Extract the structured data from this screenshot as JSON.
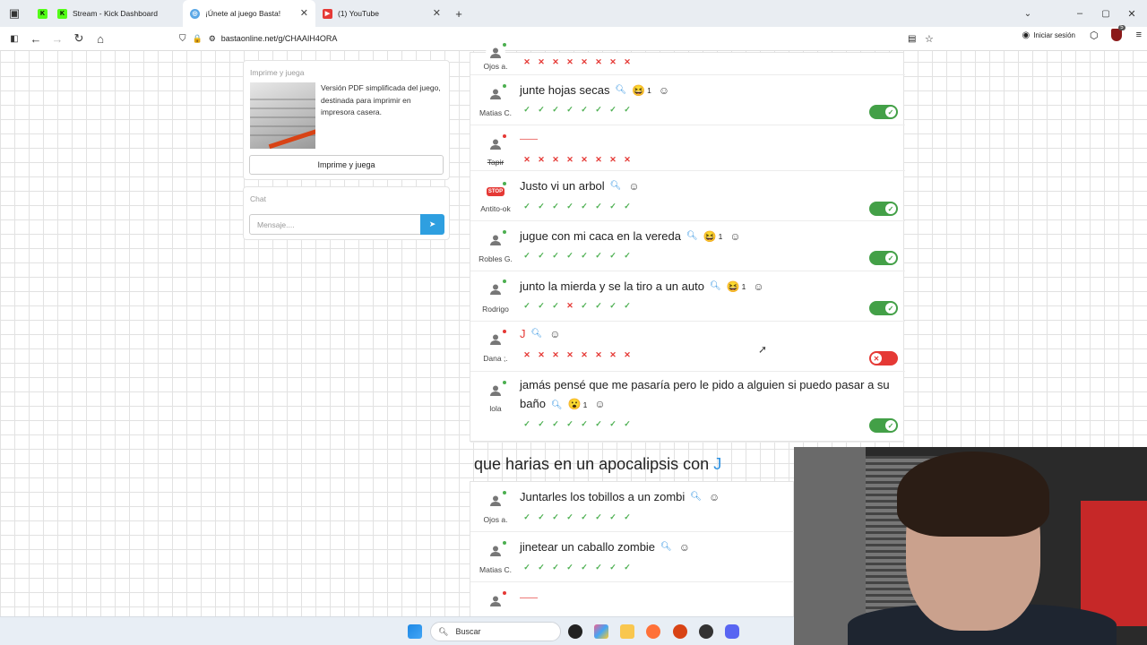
{
  "tabs": [
    {
      "label": "Stream - Kick Dashboard",
      "icon": "kick-icon",
      "active": false
    },
    {
      "label": "¡Únete al juego Basta!",
      "icon": "basta-icon",
      "active": true
    },
    {
      "label": "(1) YouTube",
      "icon": "youtube-icon",
      "active": false
    }
  ],
  "url": "bastaonline.net/g/CHAAIH4ORA",
  "sign_in": "Iniciar sesión",
  "extension_badge": "5",
  "print_panel": {
    "title": "Imprime y juega",
    "description": "Versión PDF simplificada del juego, destinada para imprimir en impresora casera.",
    "button": "Imprime y juega"
  },
  "chat_panel": {
    "title": "Chat",
    "placeholder": "Mensaje...."
  },
  "category1_rows": [
    {
      "user": "Ojos a.",
      "answer": "",
      "votes": [
        "x",
        "x",
        "x",
        "x",
        "x",
        "x",
        "x",
        "x"
      ],
      "toggle": null,
      "partial": true
    },
    {
      "user": "Matias C.",
      "answer": "junte hojas secas",
      "emoji": "😆",
      "count": "1",
      "votes": [
        "v",
        "v",
        "v",
        "v",
        "v",
        "v",
        "v",
        "v"
      ],
      "toggle": "on"
    },
    {
      "user": "Tapir",
      "answer": "——",
      "votes": [
        "x",
        "x",
        "x",
        "x",
        "x",
        "x",
        "x",
        "x"
      ],
      "toggle": null
    },
    {
      "user": "Antito-ok",
      "answer": "Justo vi un arbol",
      "votes": [
        "v",
        "v",
        "v",
        "v",
        "v",
        "v",
        "v",
        "v"
      ],
      "toggle": "on",
      "stop_avatar": "stop"
    },
    {
      "user": "Robles G.",
      "answer": "jugue con mi caca en la vereda",
      "emoji": "😆",
      "count": "1",
      "votes": [
        "v",
        "v",
        "v",
        "v",
        "v",
        "v",
        "v",
        "v"
      ],
      "toggle": "on"
    },
    {
      "user": "Rodrigo",
      "answer": "junto la mierda y se la tiro a un auto",
      "emoji": "😆",
      "count": "1",
      "votes": [
        "v",
        "v",
        "v",
        "x",
        "v",
        "v",
        "v",
        "v"
      ],
      "toggle": "on"
    },
    {
      "user": "Dana ;.",
      "answer": "J",
      "votes": [
        "x",
        "x",
        "x",
        "x",
        "x",
        "x",
        "x",
        "x"
      ],
      "toggle": "off"
    },
    {
      "user": "lola",
      "answer": "jamás pensé que me pasaría pero le pido a alguien si puedo pasar a su baño",
      "emoji": "😮",
      "count": "1",
      "votes": [
        "v",
        "v",
        "v",
        "v",
        "v",
        "v",
        "v",
        "v"
      ],
      "toggle": "on"
    }
  ],
  "question": {
    "text": "que harias en un apocalipsis con",
    "letter": "J"
  },
  "category2_rows": [
    {
      "user": "Ojos a.",
      "answer": "Juntarles los tobillos a un zombi",
      "votes": [
        "v",
        "v",
        "v",
        "v",
        "v",
        "v",
        "v",
        "v"
      ]
    },
    {
      "user": "Matias C.",
      "answer": "jinetear un caballo zombie",
      "votes": [
        "v",
        "v",
        "v",
        "v",
        "v",
        "v",
        "v",
        "v"
      ]
    },
    {
      "user": "",
      "answer": "——",
      "votes": [
        "x",
        "x",
        "x",
        "x",
        "x",
        "x",
        "x",
        "x"
      ]
    }
  ],
  "taskbar": {
    "search": "Buscar"
  },
  "colors": {
    "accent": "#2e9fe0",
    "ok": "#43a047",
    "error": "#e53935"
  }
}
